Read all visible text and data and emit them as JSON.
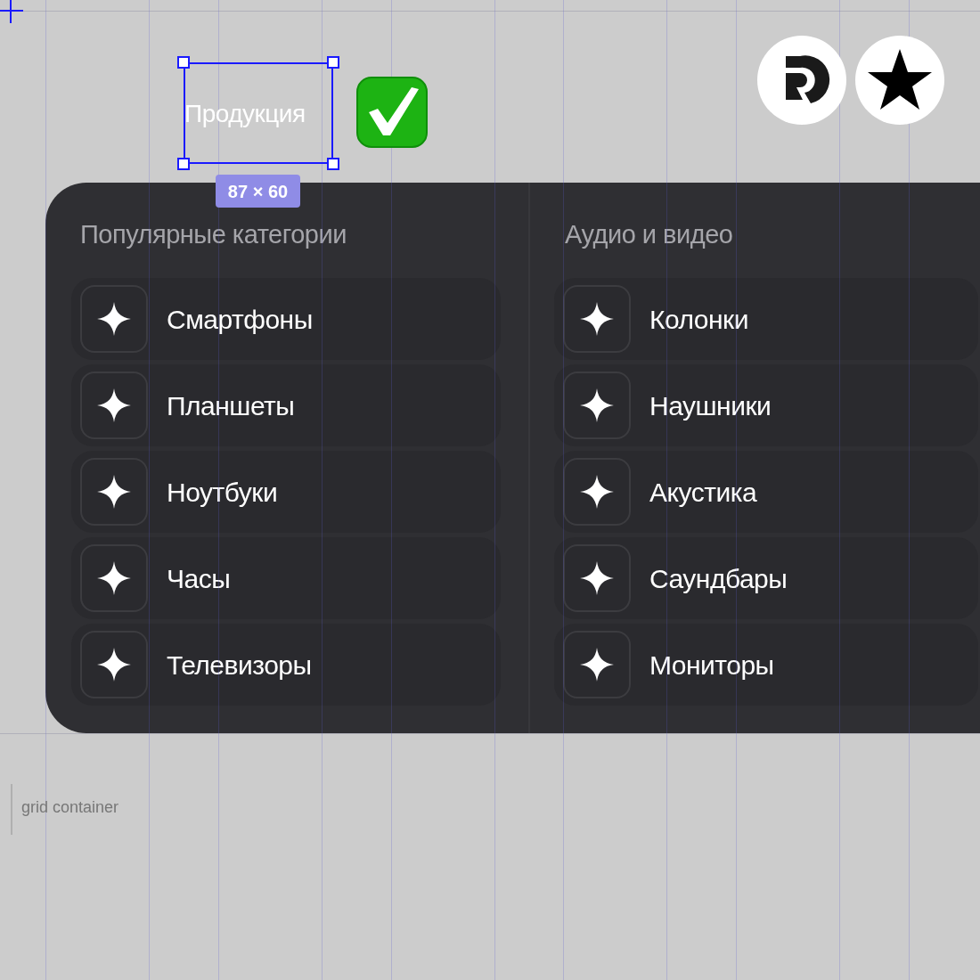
{
  "selection": {
    "label": "Продукция",
    "size_badge": "87 × 60"
  },
  "panel": {
    "columns": [
      {
        "title": "Популярные категории",
        "items": [
          {
            "label": "Смартфоны"
          },
          {
            "label": "Планшеты"
          },
          {
            "label": "Ноутбуки"
          },
          {
            "label": "Часы"
          },
          {
            "label": "Телевизоры"
          }
        ]
      },
      {
        "title": "Аудио и видео",
        "items": [
          {
            "label": "Колонки"
          },
          {
            "label": "Наушники"
          },
          {
            "label": "Акустика"
          },
          {
            "label": "Саундбары"
          },
          {
            "label": "Мониторы"
          }
        ]
      }
    ]
  },
  "canvas_label": "grid container"
}
